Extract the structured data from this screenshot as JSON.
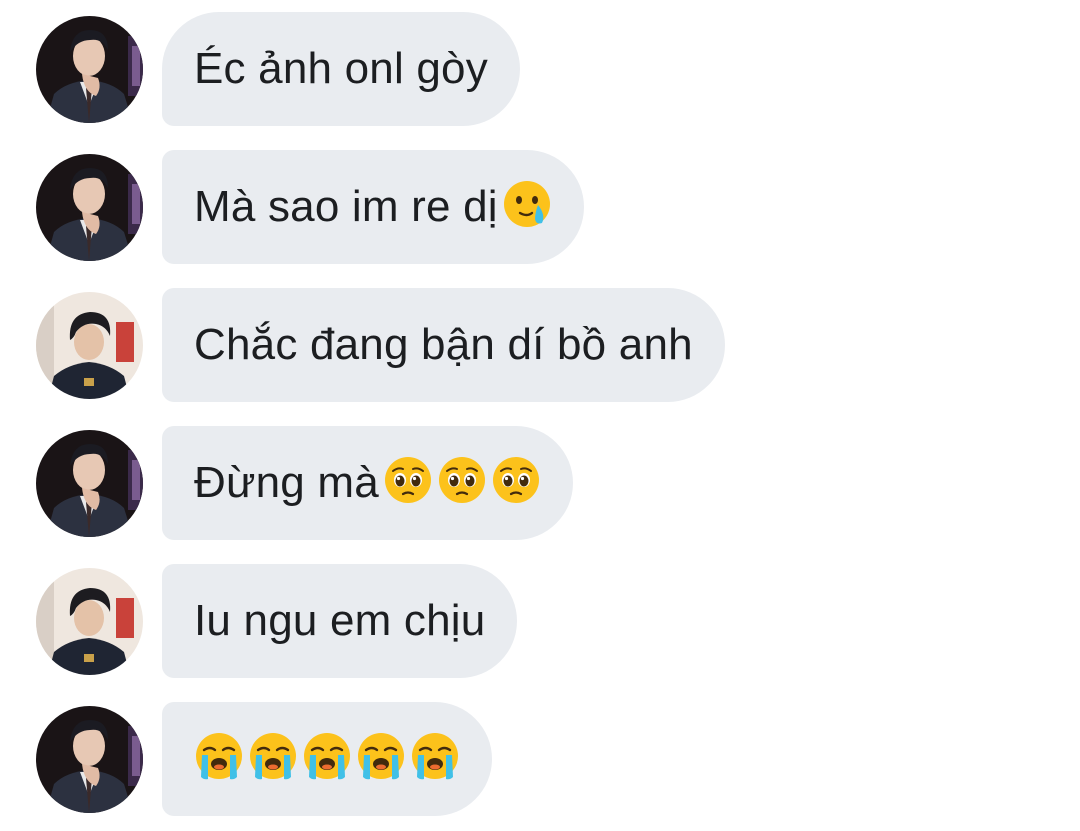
{
  "messages": [
    {
      "avatar": "avatar-a",
      "text": "Éc ảnh onl gòy",
      "emojis": []
    },
    {
      "avatar": "avatar-a",
      "text": "Mà sao im re dị",
      "emojis": [
        "face-holding-back-tears-icon"
      ]
    },
    {
      "avatar": "avatar-b",
      "text": "Chắc đang bận dí bồ anh",
      "emojis": []
    },
    {
      "avatar": "avatar-a",
      "text": "Đừng mà",
      "emojis": [
        "pleading-face-icon",
        "pleading-face-icon",
        "pleading-face-icon"
      ]
    },
    {
      "avatar": "avatar-b",
      "text": "Iu ngu em chịu",
      "emojis": []
    },
    {
      "avatar": "avatar-a",
      "text": "",
      "emojis": [
        "loudly-crying-face-icon",
        "loudly-crying-face-icon",
        "loudly-crying-face-icon",
        "loudly-crying-face-icon",
        "loudly-crying-face-icon"
      ]
    }
  ],
  "colors": {
    "bubble_bg": "#e9ecf0",
    "text": "#1c1e21",
    "background": "#ffffff"
  }
}
